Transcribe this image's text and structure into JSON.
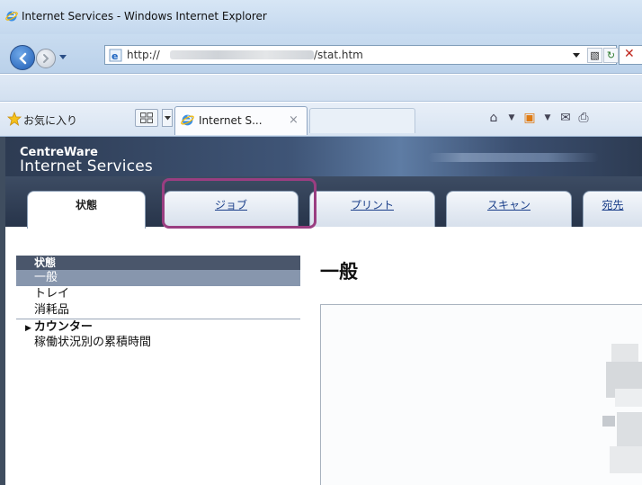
{
  "window": {
    "title": "Internet Services - Windows Internet Explorer"
  },
  "address_bar": {
    "prefix": "http://",
    "suffix": "/stat.htm"
  },
  "favorites": {
    "label": "お気に入り"
  },
  "browser_tab": {
    "label": "Internet S...",
    "close": "×"
  },
  "header": {
    "brand_line1": "CentreWare",
    "brand_line2": "Internet Services"
  },
  "nav_tabs": [
    {
      "label": "状態"
    },
    {
      "label": "ジョブ"
    },
    {
      "label": "プリント"
    },
    {
      "label": "スキャン"
    },
    {
      "label": "宛先"
    }
  ],
  "sidebar": {
    "heading": "状態",
    "items": [
      {
        "label": "一般"
      },
      {
        "label": "トレイ"
      },
      {
        "label": "消耗品"
      },
      {
        "label": "カウンター"
      },
      {
        "label": "稼働状況別の累積時間"
      }
    ]
  },
  "main": {
    "heading": "一般"
  },
  "colors": {
    "highlight": "#9a3e81",
    "header": "#2d3b52",
    "sidebar_selected": "#8796ad"
  }
}
